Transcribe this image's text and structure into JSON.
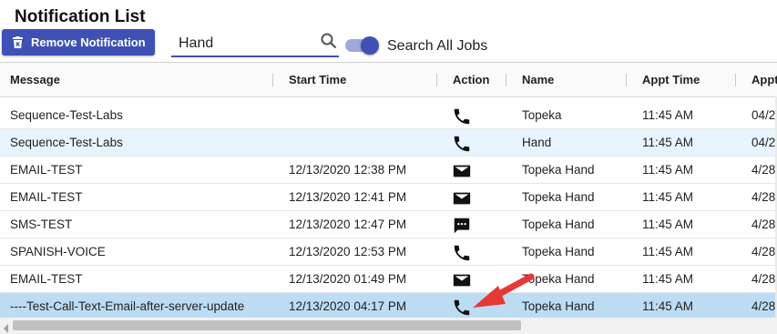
{
  "page": {
    "title": "Notification List",
    "remove_button_label": "Remove Notification",
    "icons": {
      "remove": "trash-icon",
      "search": "search-icon"
    },
    "accent_color": "#3f51b5"
  },
  "search": {
    "value": "Hand",
    "placeholder": ""
  },
  "toggle": {
    "label": "Search All Jobs",
    "on": true
  },
  "grid": {
    "columns": [
      "Message",
      "Start Time",
      "Action",
      "Name",
      "Appt Time",
      "Appt"
    ],
    "rows": [
      {
        "message": "Sequence-Test-Labs",
        "start": "",
        "action": "phone-icon",
        "name": "Topeka",
        "appt_time": "11:45 AM",
        "appt": "04/2"
      },
      {
        "message": "Sequence-Test-Labs",
        "start": "",
        "action": "phone-icon",
        "name": "Hand",
        "appt_time": "11:45 AM",
        "appt": "04/2"
      },
      {
        "message": "EMAIL-TEST",
        "start": "12/13/2020 12:38 PM",
        "action": "email-icon",
        "name": "Topeka Hand",
        "appt_time": "11:45 AM",
        "appt": "4/28"
      },
      {
        "message": "EMAIL-TEST",
        "start": "12/13/2020 12:41 PM",
        "action": "email-icon",
        "name": "Topeka Hand",
        "appt_time": "11:45 AM",
        "appt": "4/28"
      },
      {
        "message": "SMS-TEST",
        "start": "12/13/2020 12:47 PM",
        "action": "sms-icon",
        "name": "Topeka Hand",
        "appt_time": "11:45 AM",
        "appt": "4/28"
      },
      {
        "message": "SPANISH-VOICE",
        "start": "12/13/2020 12:53 PM",
        "action": "phone-icon",
        "name": "Topeka Hand",
        "appt_time": "11:45 AM",
        "appt": "4/28"
      },
      {
        "message": "EMAIL-TEST",
        "start": "12/13/2020 01:49 PM",
        "action": "email-icon",
        "name": "Topeka Hand",
        "appt_time": "11:45 AM",
        "appt": "4/28"
      },
      {
        "message": "----Test-Call-Text-Email-after-server-update",
        "start": "12/13/2020 04:17 PM",
        "action": "phone-icon",
        "name": "Topeka Hand",
        "appt_time": "11:45 AM",
        "appt": "4/28"
      }
    ],
    "selected_row": 7,
    "annotation": "red-arrow-icon"
  }
}
